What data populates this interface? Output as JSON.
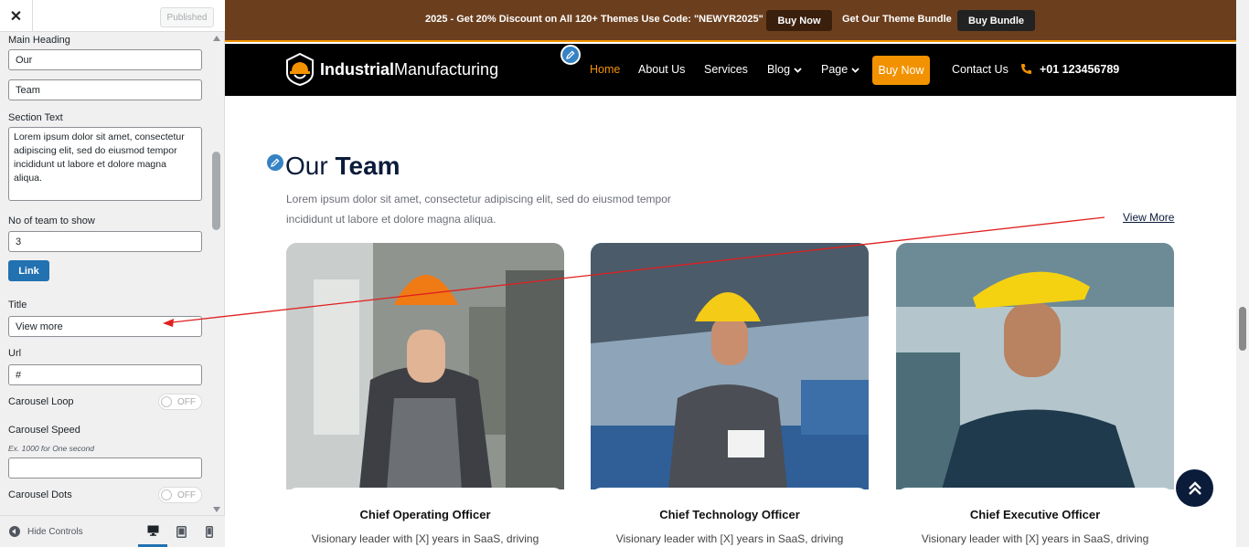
{
  "sidebar": {
    "close_label": "✕",
    "published_label": "Published",
    "fields": {
      "main_heading_label": "Main Heading",
      "heading_part1": "Our",
      "heading_part2": "Team",
      "section_text_label": "Section Text",
      "section_text_value": "Lorem ipsum dolor sit amet, consectetur adipiscing elit, sed do eiusmod tempor incididunt ut labore et dolore magna aliqua.",
      "team_count_label": "No of team to show",
      "team_count_value": "3",
      "link_button": "Link",
      "title_label": "Title",
      "title_value": "View more",
      "url_label": "Url",
      "url_value": "#",
      "carousel_loop_label": "Carousel Loop",
      "carousel_loop_state": "OFF",
      "carousel_speed_label": "Carousel Speed",
      "carousel_speed_hint": "Ex. 1000 for One second",
      "carousel_speed_value": "",
      "carousel_dots_label": "Carousel Dots",
      "carousel_dots_state": "OFF"
    },
    "footer": {
      "hide_controls": "Hide Controls"
    }
  },
  "preview": {
    "promo": {
      "text": "2025 - Get 20% Discount on All 120+ Themes Use Code: \"NEWYR2025\"",
      "buy_now": "Buy Now",
      "bundle_text": "Get Our Theme Bundle",
      "buy_bundle": "Buy Bundle"
    },
    "nav": {
      "logo_bold": "Industrial",
      "logo_light": "Manufacturing",
      "items": [
        "Home",
        "About Us",
        "Services",
        "Blog",
        "Page"
      ],
      "buy_now": "Buy Now",
      "contact": "Contact Us",
      "phone": "+01 123456789"
    },
    "section": {
      "title_part1": "Our",
      "title_part2": "Team",
      "text": "Lorem ipsum dolor sit amet, consectetur adipiscing elit, sed do eiusmod tempor incididunt ut labore et dolore magna aliqua.",
      "view_more": "View More"
    },
    "cards": [
      {
        "role": "Chief Operating Officer",
        "desc": "Visionary leader with [X] years in SaaS, driving"
      },
      {
        "role": "Chief Technology Officer",
        "desc": "Visionary leader with [X] years in SaaS, driving"
      },
      {
        "role": "Chief Executive Officer",
        "desc": "Visionary leader with [X] years in SaaS, driving"
      }
    ]
  },
  "colors": {
    "promo_bg": "#6b3f1e",
    "accent": "#f39200",
    "nav_bg": "#000000",
    "heading": "#0b1b3a",
    "wp_blue": "#2271b1",
    "annotation_arrow": "#e02020"
  },
  "icons": [
    "close-icon",
    "pencil-icon",
    "hard-hat-logo-icon",
    "chevron-down-icon",
    "phone-icon",
    "double-chevron-up-icon",
    "desktop-icon",
    "tablet-icon",
    "mobile-icon",
    "collapse-icon"
  ]
}
